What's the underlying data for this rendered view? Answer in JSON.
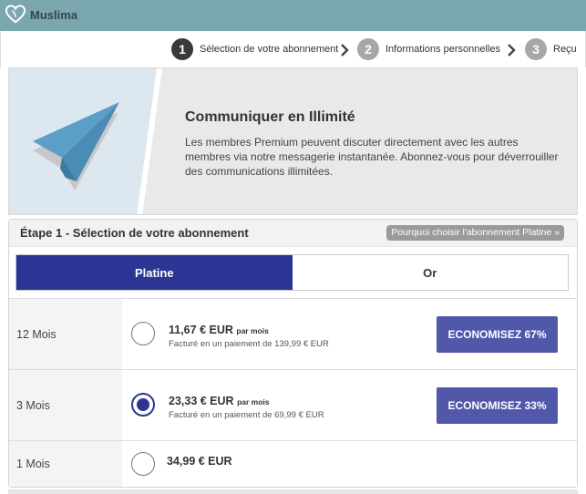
{
  "app": {
    "name": "Muslima"
  },
  "steps": [
    {
      "number": "1",
      "label": "Sélection de votre abonnement",
      "active": true
    },
    {
      "number": "2",
      "label": "Informations personnelles",
      "active": false
    },
    {
      "number": "3",
      "label": "Reçu",
      "active": false
    }
  ],
  "hero": {
    "title": "Communiquer en Illimité",
    "description": "Les membres Premium peuvent discuter directement avec les autres membres via notre messagerie instantanée. Abonnez-vous pour déverrouiller des communications illimitées."
  },
  "section": {
    "title": "Étape 1 - Sélection de votre abonnement",
    "why_button": "Pourquoi choisir l'abonnement Platine »"
  },
  "plans": [
    {
      "label": "Platine",
      "active": true
    },
    {
      "label": "Or",
      "active": false
    }
  ],
  "options": [
    {
      "duration": "12 Mois",
      "price": "11,67 € EUR",
      "per": "par mois",
      "billed": "Facturé en un paiement de 139,99 € EUR",
      "save": "ECONOMISEZ 67%",
      "selected": false
    },
    {
      "duration": "3 Mois",
      "price": "23,33 € EUR",
      "per": "par mois",
      "billed": "Facturé en un paiement de 69,99 € EUR",
      "save": "ECONOMISEZ 33%",
      "selected": true
    },
    {
      "duration": "1 Mois",
      "price": "34,99 € EUR",
      "per": "",
      "billed": "",
      "save": "",
      "selected": false
    }
  ],
  "colors": {
    "topbar": "#7aa6ad",
    "primary": "#2c3593",
    "save_button": "#5158aa",
    "plane": "#5b9fc8"
  }
}
